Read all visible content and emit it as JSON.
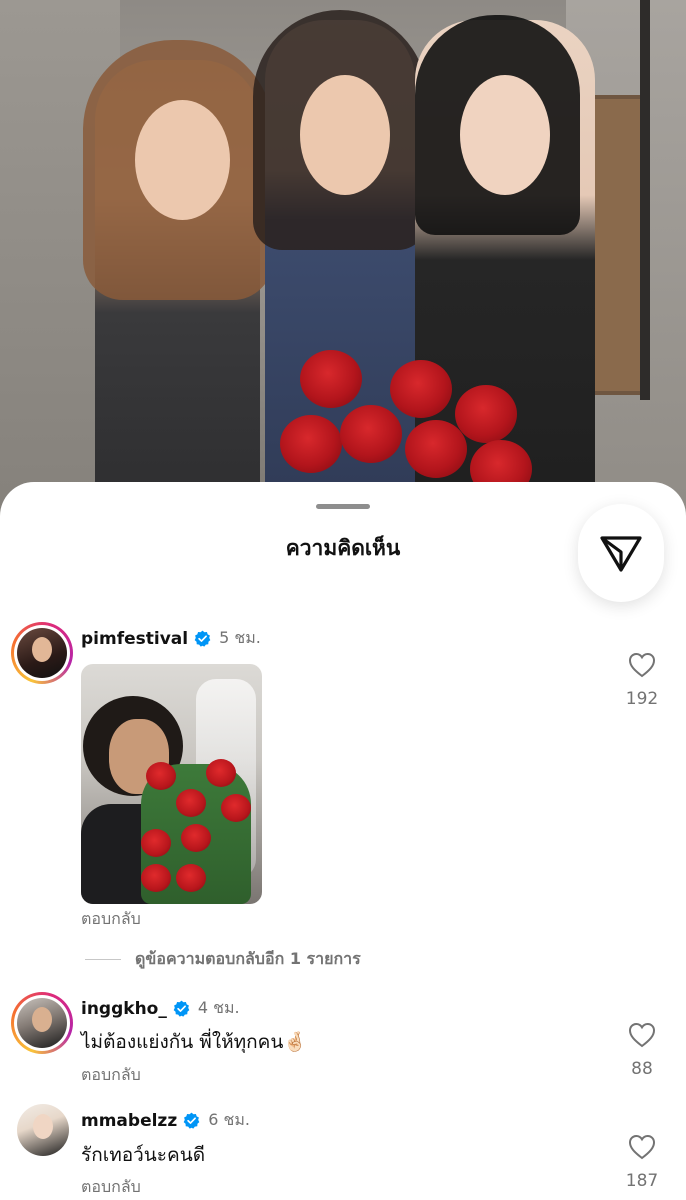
{
  "sheet": {
    "title": "ความคิดเห็น",
    "share_icon": "send-paper-plane-icon"
  },
  "comments": [
    {
      "username": "pimfestival",
      "verified": true,
      "time": "5 ชม.",
      "text": "",
      "has_image": true,
      "reply_label": "ตอบกลับ",
      "like_count": "192",
      "view_replies_label": "ดูข้อความตอบกลับอีก 1 รายการ"
    },
    {
      "username": "inggkho_",
      "verified": true,
      "time": "4 ชม.",
      "text": "ไม่ต้องแย่งกัน พี่ให้ทุกคน🤞🏻",
      "reply_label": "ตอบกลับ",
      "like_count": "88"
    },
    {
      "username": "mmabelzz",
      "verified": true,
      "time": "6 ชม.",
      "text": "รักเทอว์นะคนดี",
      "reply_label": "ตอบกลับ",
      "like_count": "187"
    }
  ],
  "colors": {
    "verified_blue": "#0095f6",
    "secondary_text": "#737373",
    "story_ring": "#dd2a7b"
  }
}
